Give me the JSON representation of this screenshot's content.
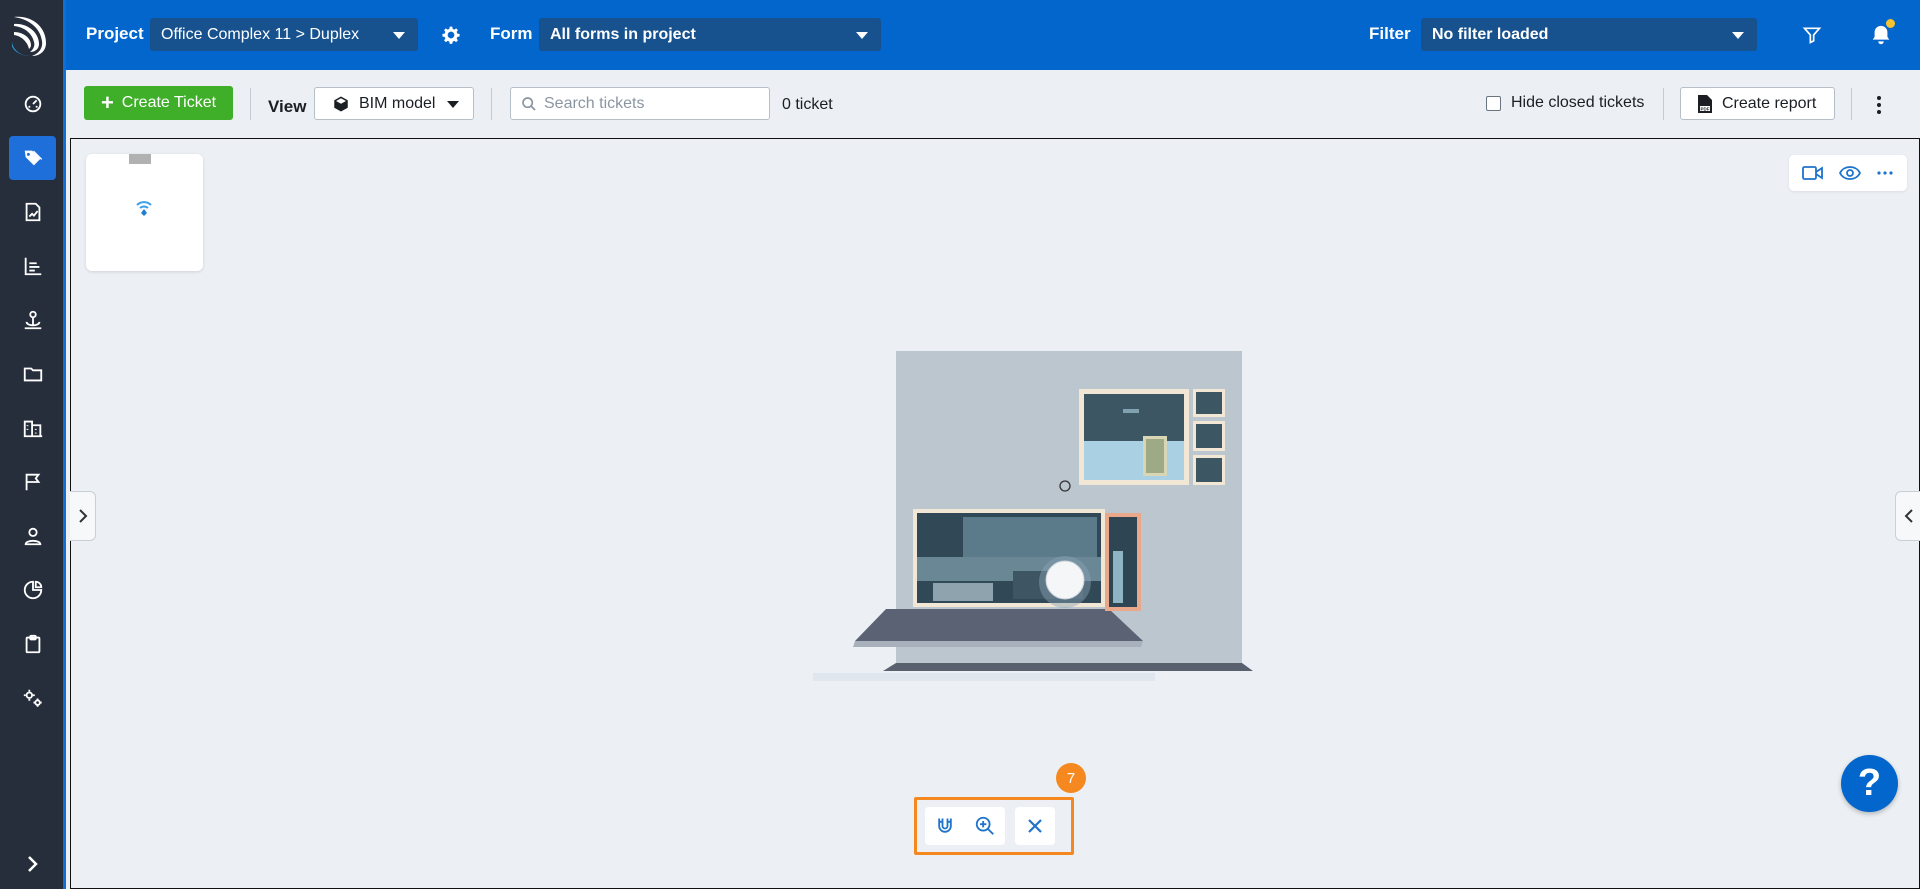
{
  "topbar": {
    "project_label": "Project",
    "project_value": "Office Complex 11 > Duplex",
    "form_label": "Form",
    "form_value": "All forms in project",
    "filter_label": "Filter",
    "filter_value": "No filter loaded",
    "notification_dot_color": "#f7c431"
  },
  "toolbar": {
    "create_ticket_label": "Create Ticket",
    "view_label": "View",
    "view_value": "BIM model",
    "search_placeholder": "Search tickets",
    "search_value": "",
    "ticket_count": "0 ticket",
    "hide_closed_label": "Hide closed tickets",
    "hide_closed_checked": false,
    "create_report_label": "Create report"
  },
  "sidebar": {
    "items": [
      {
        "icon": "dashboard-icon"
      },
      {
        "icon": "tickets-tag-icon",
        "active": true
      },
      {
        "icon": "forms-icon"
      },
      {
        "icon": "reports-chart-icon"
      },
      {
        "icon": "anchor-icon"
      },
      {
        "icon": "folder-icon"
      },
      {
        "icon": "buildings-icon"
      },
      {
        "icon": "flag-icon"
      },
      {
        "icon": "user-icon"
      },
      {
        "icon": "pie-chart-icon"
      },
      {
        "icon": "clipboard-icon"
      },
      {
        "icon": "settings-gears-icon"
      }
    ]
  },
  "viewer": {
    "tool_badge": "7",
    "help_label": "?"
  },
  "colors": {
    "brand_blue": "#0366cc",
    "sidebar_bg": "#262e3b",
    "create_green": "#3fae29",
    "highlight_orange": "#f5891f"
  }
}
